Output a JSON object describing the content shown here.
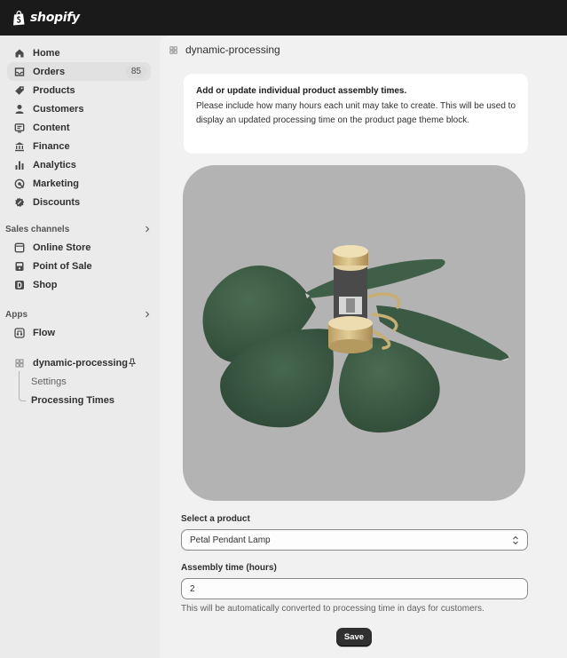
{
  "brand": {
    "name": "shopify"
  },
  "sidebar": {
    "items": [
      {
        "label": "Home",
        "icon": "home-icon"
      },
      {
        "label": "Orders",
        "icon": "inbox-icon",
        "badge": "85"
      },
      {
        "label": "Products",
        "icon": "tag-icon"
      },
      {
        "label": "Customers",
        "icon": "person-icon"
      },
      {
        "label": "Content",
        "icon": "content-icon"
      },
      {
        "label": "Finance",
        "icon": "bank-icon"
      },
      {
        "label": "Analytics",
        "icon": "bar-chart-icon"
      },
      {
        "label": "Marketing",
        "icon": "target-icon"
      },
      {
        "label": "Discounts",
        "icon": "discount-icon"
      }
    ],
    "sales_channels": {
      "title": "Sales channels",
      "items": [
        {
          "label": "Online Store",
          "icon": "store-icon"
        },
        {
          "label": "Point of Sale",
          "icon": "pos-icon"
        },
        {
          "label": "Shop",
          "icon": "shop-icon"
        }
      ]
    },
    "apps": {
      "title": "Apps",
      "items": [
        {
          "label": "Flow",
          "icon": "flow-icon"
        }
      ]
    },
    "app": {
      "label": "dynamic-processing",
      "icon": "app-grid-icon",
      "sub_items": [
        {
          "label": "Settings"
        },
        {
          "label": "Processing Times"
        }
      ]
    }
  },
  "main": {
    "title": "dynamic-processing",
    "info": {
      "title": "Add or update individual product assembly times.",
      "text": "Please include how many hours each unit may take to create. This will be used to display an updated processing time on the product page theme block."
    },
    "product_select": {
      "label": "Select a product",
      "value": "Petal Pendant Lamp"
    },
    "assembly_time": {
      "label": "Assembly time (hours)",
      "value": "2",
      "help": "This will be automatically converted to processing time in days for customers."
    },
    "save_label": "Save"
  },
  "colors": {
    "topbar": "#1a1a1a",
    "sidebar_bg": "#ebebeb",
    "main_bg": "#f1f1f1",
    "petal_green": "#3b5a44",
    "brass": "#d9c08a",
    "button_dark": "#303030"
  }
}
